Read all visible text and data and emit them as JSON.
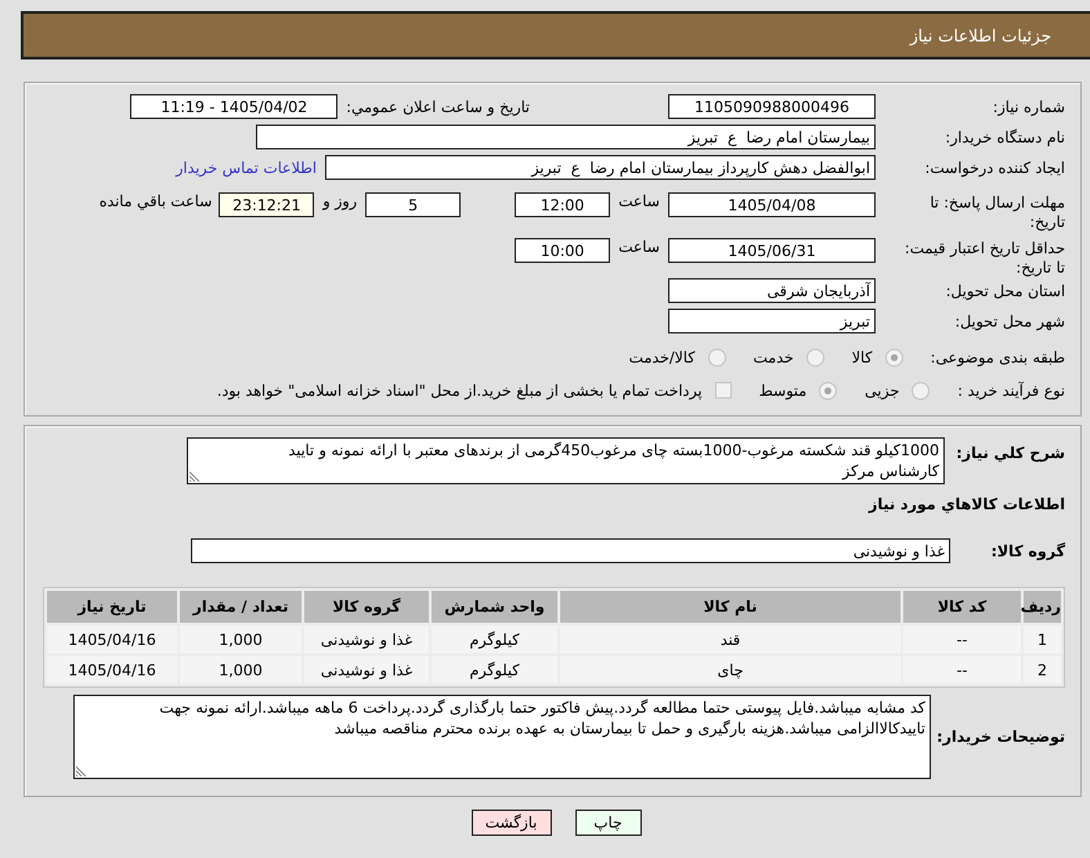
{
  "header": {
    "title": "جزئیات اطلاعات نیاز"
  },
  "details": {
    "need_number": {
      "label": "شماره نیاز:",
      "value": "1105090988000496"
    },
    "announce_datetime": {
      "label": "تاریخ و ساعت اعلان عمومي:",
      "value": "1405/04/02 - 11:19"
    },
    "buyer_org": {
      "label": "نام دستگاه خریدار:",
      "value": "بیمارستان امام رضا  ع  تبریز"
    },
    "requester": {
      "label": "ایجاد کننده درخواست:",
      "value": "ابوالفضل دهش کارپرداز بیمارستان امام رضا  ع  تبریز",
      "link": "اطلاعات تماس خریدار"
    },
    "reply_deadline": {
      "label": "مهلت ارسال پاسخ: تا تاریخ:",
      "date": "1405/04/08",
      "time_label": "ساعت",
      "time": "12:00",
      "days": "5",
      "days_label": "روز و",
      "remaining": "23:12:21",
      "remaining_label": "ساعت باقي مانده"
    },
    "price_validity": {
      "label": "حداقل تاریخ اعتبار قیمت: تا تاریخ:",
      "date": "1405/06/31",
      "time_label": "ساعت",
      "time": "10:00"
    },
    "province": {
      "label": "استان محل تحویل:",
      "value": "آذربایجان شرقی"
    },
    "city": {
      "label": "شهر محل تحویل:",
      "value": "تبریز"
    },
    "category": {
      "label": "طبقه بندی موضوعی:",
      "options": [
        {
          "label": "کالا",
          "selected": true,
          "disabled": true
        },
        {
          "label": "خدمت",
          "selected": false,
          "disabled": true
        },
        {
          "label": "کالا/خدمت",
          "selected": false,
          "disabled": true
        }
      ]
    },
    "process": {
      "label": "نوع فرآیند خرید :",
      "options": [
        {
          "label": "جزیی",
          "selected": false,
          "disabled": true
        },
        {
          "label": "متوسط",
          "selected": true,
          "disabled": true
        }
      ],
      "treasury": {
        "label": "پرداخت تمام یا بخشی از مبلغ خرید.از محل \"اسناد خزانه اسلامی\" خواهد بود.",
        "checked": false,
        "disabled": true
      }
    }
  },
  "description": {
    "label": "شرح کلي نیاز:",
    "value": "1000کیلو قند شکسته مرغوب-1000بسته چای مرغوب450گرمی از برندهای معتبر با ارائه نمونه و تایید کارشناس مرکز"
  },
  "goods_heading": "اطلاعات کالاهاي مورد نیاز",
  "goods_group": {
    "label": "گروه کالا:",
    "value": "غذا و نوشیدنی"
  },
  "table": {
    "columns": [
      "ردیف",
      "کد کالا",
      "نام کالا",
      "واحد شمارش",
      "گروه کالا",
      "تعداد / مقدار",
      "تاریخ نیاز"
    ],
    "rows": [
      [
        "1",
        "--",
        "قند",
        "کیلوگرم",
        "غذا و نوشیدنی",
        "1,000",
        "1405/04/16"
      ],
      [
        "2",
        "--",
        "چای",
        "کیلوگرم",
        "غذا و نوشیدنی",
        "1,000",
        "1405/04/16"
      ]
    ]
  },
  "buyer_notes": {
    "label": "توضیحات خریدار:",
    "value": "کد مشابه میباشد.فایل پیوستی حتما مطالعه گردد.پیش فاکتور حتما بارگذاری گردد.پرداخت 6 ماهه میباشد.ارائه نمونه جهت تاییدکالاالزامی میباشد.هزینه بارگیری و حمل تا بیمارستان به عهده برنده محترم مناقصه میباشد"
  },
  "buttons": [
    {
      "label": "چاپ",
      "kind": "print"
    },
    {
      "label": "بازگشت",
      "kind": "back"
    }
  ]
}
